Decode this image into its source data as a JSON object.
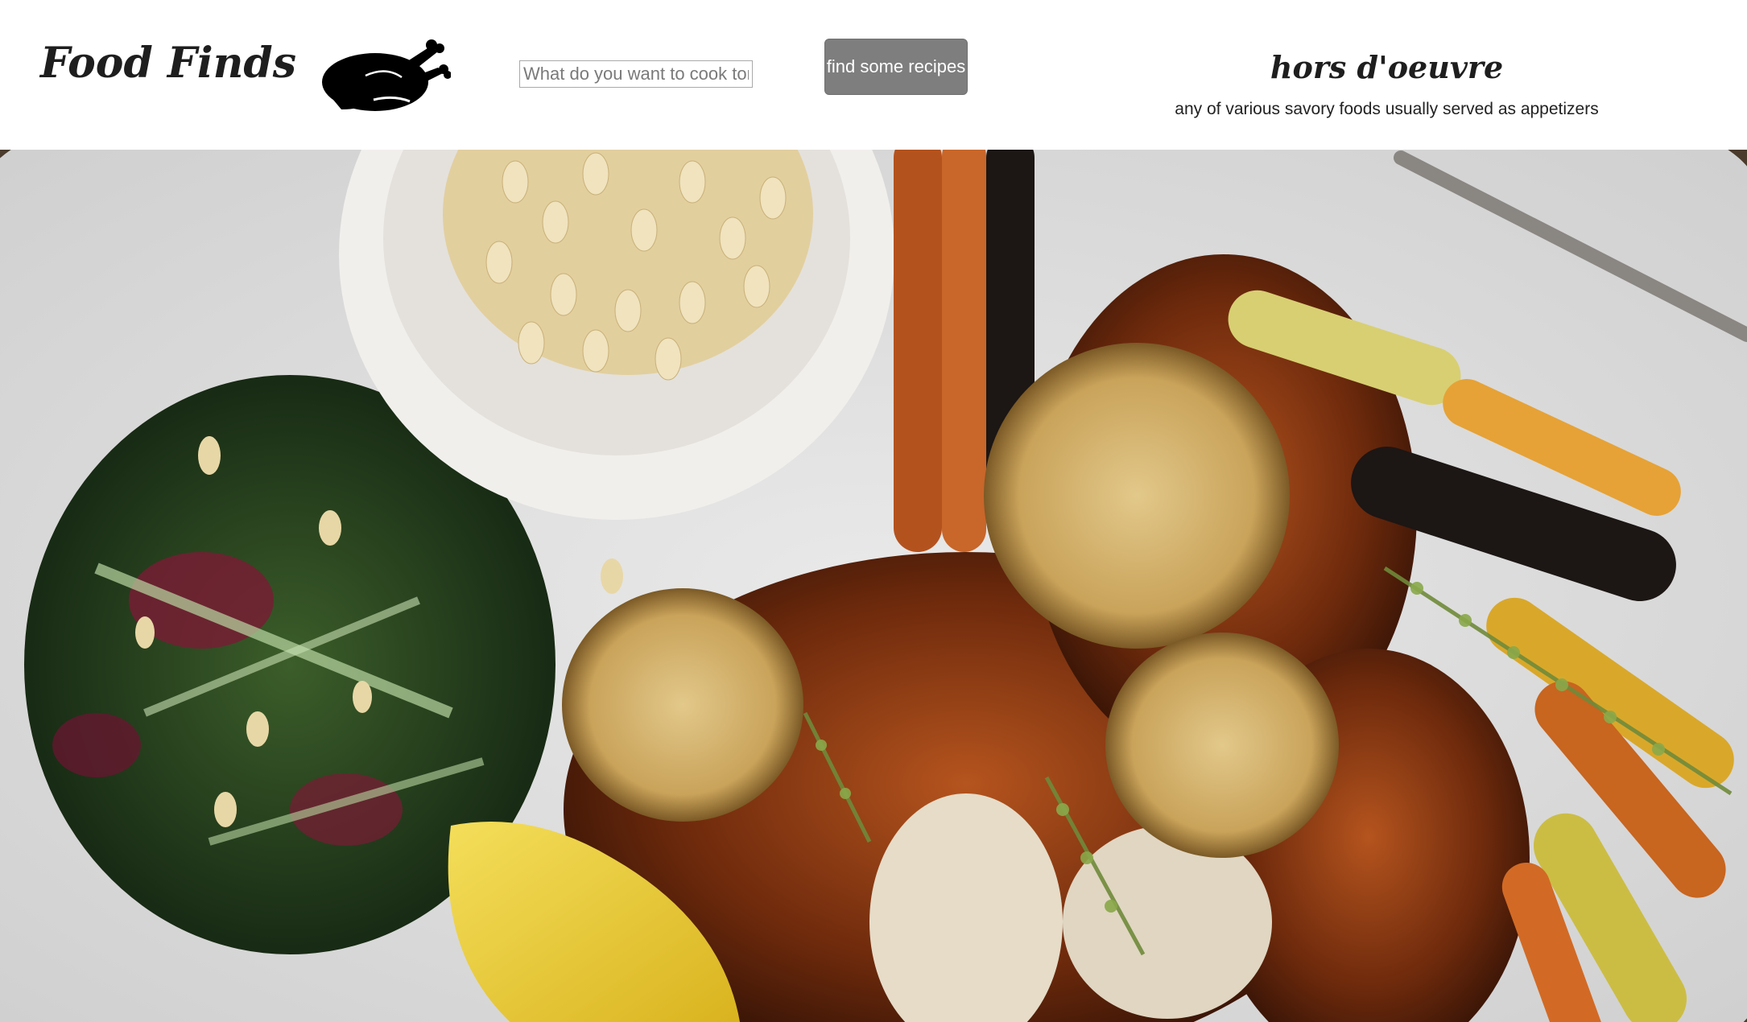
{
  "header": {
    "brand": "Food Finds",
    "logo_icon": "roast-chicken-icon",
    "search": {
      "placeholder": "What do you want to cook tonight?",
      "value": ""
    },
    "search_button_label": "find some recipes",
    "word_of_day": {
      "title": "hors d'oeuvre",
      "definition": "any of various savory foods usually served as appetizers"
    }
  },
  "hero": {
    "description": "roast chicken platter with kale salad, pine nuts, lemons and carrots"
  },
  "colors": {
    "button_bg": "#7e7e7e",
    "button_text": "#ffffff",
    "text": "#1e1e1e",
    "header_bg": "#ffffff"
  }
}
